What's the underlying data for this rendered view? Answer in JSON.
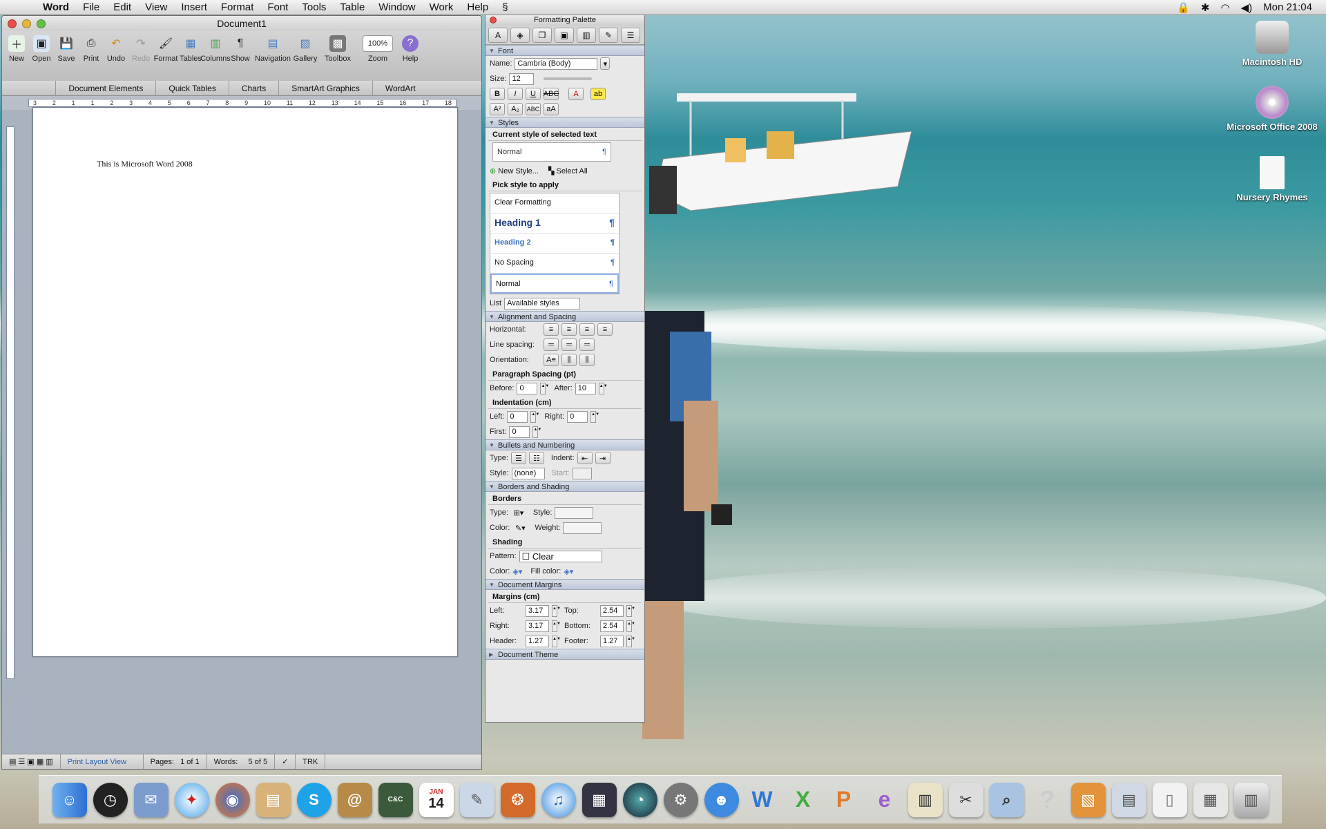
{
  "menubar": {
    "app": "Word",
    "items": [
      "File",
      "Edit",
      "View",
      "Insert",
      "Format",
      "Font",
      "Tools",
      "Table",
      "Window",
      "Work",
      "Help"
    ],
    "clock": "Mon 21:04"
  },
  "word": {
    "title": "Document1",
    "toolbar": [
      "New",
      "Open",
      "Save",
      "Print",
      "Undo",
      "Redo",
      "Format",
      "Tables",
      "Columns",
      "Show",
      "Navigation",
      "Gallery",
      "Toolbox",
      "Zoom",
      "Help"
    ],
    "zoom": "100%",
    "ribbon": [
      "Document Elements",
      "Quick Tables",
      "Charts",
      "SmartArt Graphics",
      "WordArt"
    ],
    "ruler_ticks": [
      "3",
      "2",
      "1",
      "1",
      "2",
      "3",
      "4",
      "5",
      "6",
      "7",
      "8",
      "9",
      "10",
      "11",
      "12",
      "13",
      "14",
      "15",
      "16",
      "17",
      "18"
    ],
    "document_text": "This is Microsoft Word 2008",
    "status": {
      "view": "Print Layout View",
      "pages_label": "Pages:",
      "pages": "1 of 1",
      "words_label": "Words:",
      "words": "5 of 5",
      "trk": "TRK"
    }
  },
  "palette": {
    "title": "Formatting Palette",
    "font": {
      "section": "Font",
      "name_label": "Name:",
      "name": "Cambria (Body)",
      "size_label": "Size:",
      "size": "12"
    },
    "styles": {
      "section": "Styles",
      "current_label": "Current style of selected text",
      "current": "Normal",
      "new_style": "New Style...",
      "select_all": "Select All",
      "pick_label": "Pick style to apply",
      "list": [
        "Clear Formatting",
        "Heading 1",
        "Heading 2",
        "No Spacing",
        "Normal"
      ],
      "list_label": "List",
      "list_value": "Available styles"
    },
    "align": {
      "section": "Alignment and Spacing",
      "horizontal": "Horizontal:",
      "line_spacing": "Line spacing:",
      "orientation": "Orientation:",
      "para_spacing": "Paragraph Spacing (pt)",
      "before_label": "Before:",
      "before": "0",
      "after_label": "After:",
      "after": "10",
      "indent_title": "Indentation (cm)",
      "left_label": "Left:",
      "left": "0",
      "right_label": "Right:",
      "right": "0",
      "first_label": "First:",
      "first": "0"
    },
    "bullets": {
      "section": "Bullets and Numbering",
      "type": "Type:",
      "indent": "Indent:",
      "style": "Style:",
      "style_value": "(none)",
      "start": "Start:"
    },
    "borders": {
      "section": "Borders and Shading",
      "borders_title": "Borders",
      "type": "Type:",
      "style": "Style:",
      "color": "Color:",
      "weight": "Weight:",
      "shading_title": "Shading",
      "pattern": "Pattern:",
      "pattern_value": "Clear",
      "color2": "Color:",
      "fill": "Fill color:"
    },
    "margins": {
      "section": "Document Margins",
      "title": "Margins (cm)",
      "left_label": "Left:",
      "left": "3.17",
      "top_label": "Top:",
      "top": "2.54",
      "right_label": "Right:",
      "right": "3.17",
      "bottom_label": "Bottom:",
      "bottom": "2.54",
      "header_label": "Header:",
      "header": "1.27",
      "footer_label": "Footer:",
      "footer": "1.27"
    },
    "theme": {
      "section": "Document Theme"
    }
  },
  "desktop": {
    "icons": [
      "Macintosh HD",
      "Microsoft Office 2008",
      "Nursery Rhymes"
    ]
  },
  "dock": {
    "icons": [
      "finder-icon",
      "dashboard-icon",
      "mail-icon",
      "safari-icon",
      "firefox-icon",
      "preview-icon",
      "skype-icon",
      "address-book-icon",
      "command-conquer-icon",
      "ical-icon",
      "textedit-icon",
      "iphoto-icon",
      "itunes-icon",
      "spaces-icon",
      "time-machine-icon",
      "system-preferences-icon",
      "messenger-icon",
      "word-icon",
      "excel-icon",
      "powerpoint-icon",
      "entourage-icon",
      "project-gallery-icon",
      "scissors-icon",
      "preview-photo-icon",
      "help-icon",
      "stack-icon",
      "folder-icon",
      "document-icon",
      "downloads-icon",
      "trash-icon"
    ],
    "ical_month": "JAN",
    "ical_day": "14"
  }
}
